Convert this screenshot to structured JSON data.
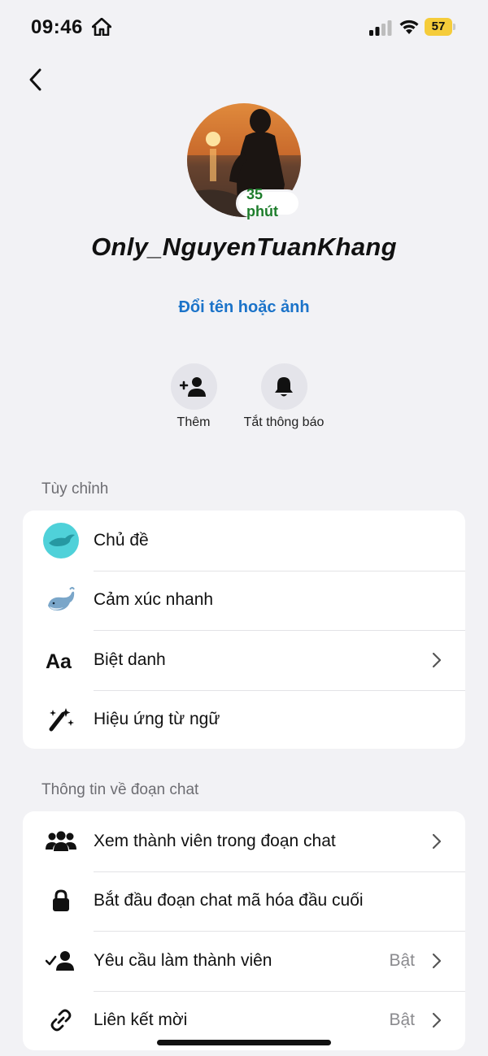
{
  "status_bar": {
    "time": "09:46",
    "home_icon": "home-icon",
    "signal_icon": "cellular-signal-icon",
    "wifi_icon": "wifi-icon",
    "battery_level": "57",
    "battery_color": "#f5cc3a"
  },
  "header": {
    "back_icon": "chevron-left-icon"
  },
  "profile": {
    "active_badge": "35 phút",
    "name": "Only_NguyenTuanKhang",
    "rename_link": "Đổi tên hoặc ảnh"
  },
  "actions": [
    {
      "label": "Thêm",
      "icon": "add-person-icon"
    },
    {
      "label": "Tắt thông báo",
      "icon": "bell-icon"
    }
  ],
  "customize": {
    "title": "Tùy chỉnh",
    "items": [
      {
        "label": "Chủ đề",
        "icon": "theme-icon"
      },
      {
        "label": "Cảm xúc nhanh",
        "icon": "whale-emoji-icon"
      },
      {
        "label": "Biệt danh",
        "icon": "aa-text-icon"
      },
      {
        "label": "Hiệu ứng từ ngữ",
        "icon": "magic-wand-icon"
      }
    ]
  },
  "chat_info": {
    "title": "Thông tin về đoạn chat",
    "items": [
      {
        "label": "Xem thành viên trong đoạn chat",
        "icon": "group-icon"
      },
      {
        "label": "Bắt đầu đoạn chat mã hóa đầu cuối",
        "icon": "lock-icon"
      },
      {
        "label": "Yêu cầu làm thành viên",
        "value": "Bật",
        "icon": "person-check-icon"
      },
      {
        "label": "Liên kết mời",
        "value": "Bật",
        "icon": "link-icon"
      }
    ]
  },
  "colors": {
    "accent_link": "#1b73c9",
    "active_green": "#1e7d2c",
    "background": "#f2f2f5"
  }
}
